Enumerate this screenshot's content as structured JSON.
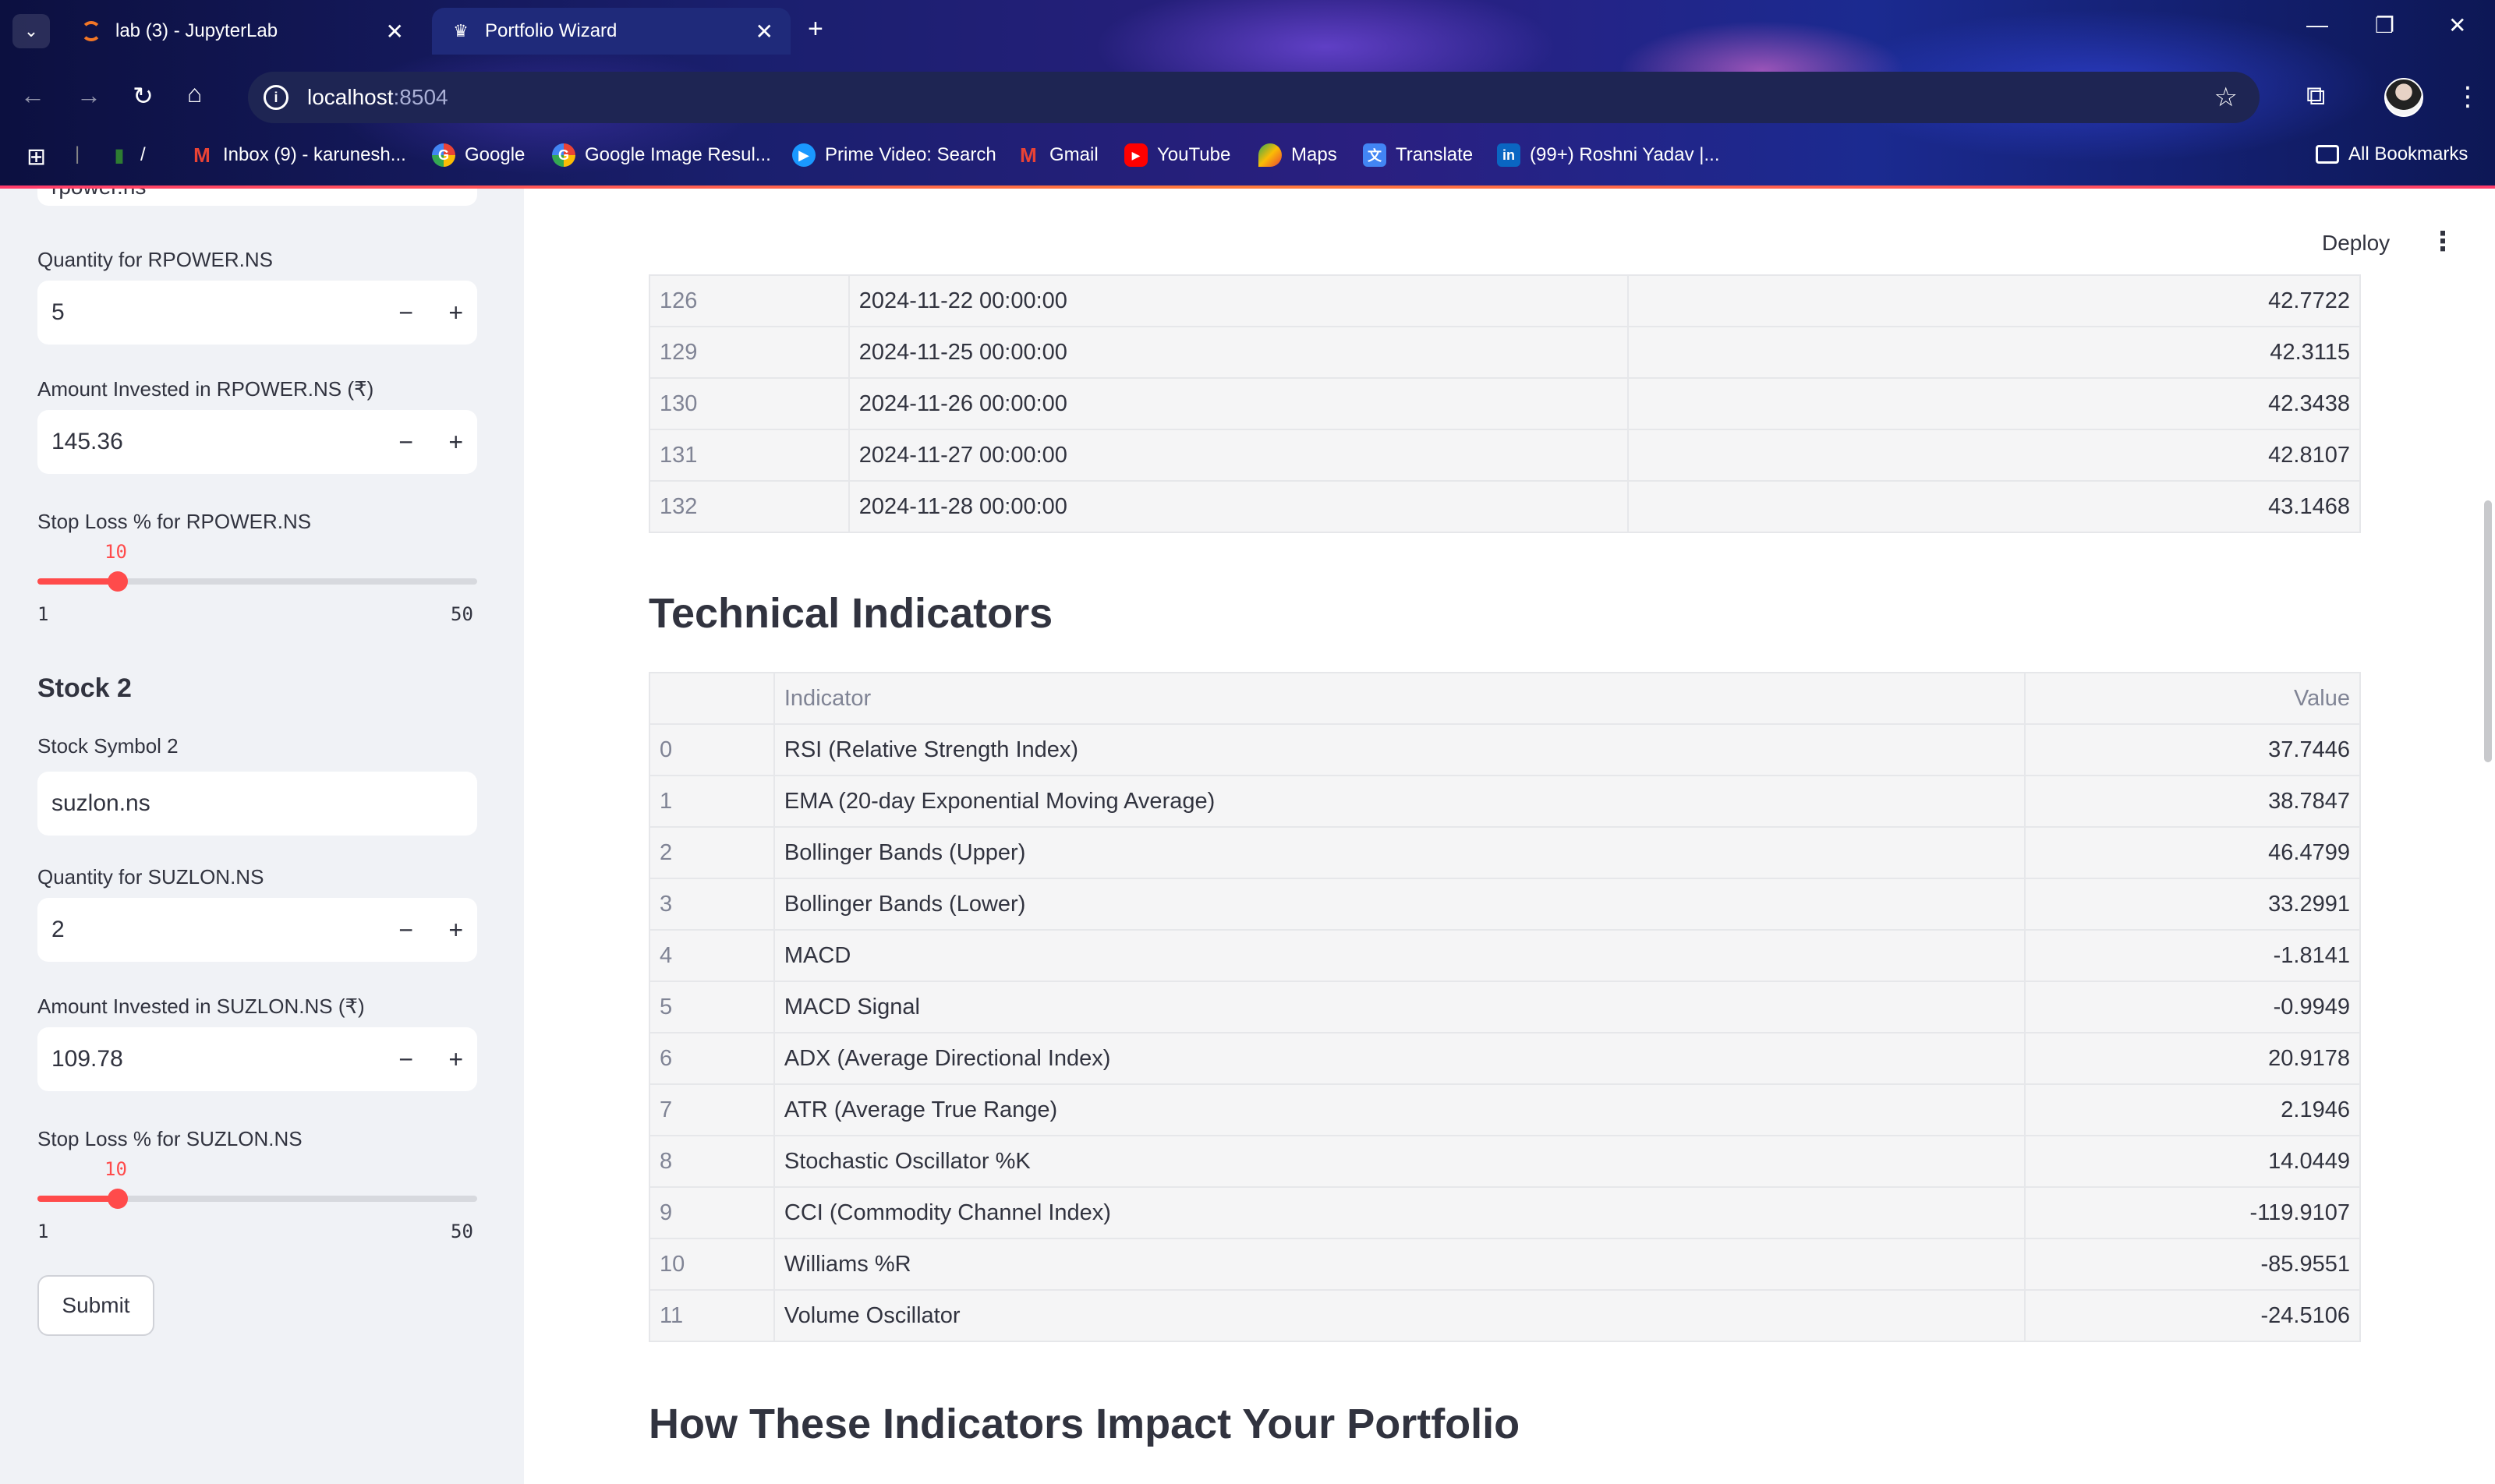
{
  "browser": {
    "tabs": [
      {
        "label": "lab (3) - JupyterLab",
        "icon": "jupyter-icon"
      },
      {
        "label": "Portfolio Wizard",
        "icon": "streamlit-crown-icon"
      }
    ],
    "url_host": "localhost",
    "url_port": ":8504",
    "bookmarks": [
      {
        "label": "Inbox (9) - karunesh...",
        "icon": "gmail-icon"
      },
      {
        "label": "Google",
        "icon": "google-icon"
      },
      {
        "label": "Google Image Resul...",
        "icon": "google-icon"
      },
      {
        "label": "Prime Video: Search",
        "icon": "prime-video-icon"
      },
      {
        "label": "Gmail",
        "icon": "gmail-icon"
      },
      {
        "label": "YouTube",
        "icon": "youtube-icon"
      },
      {
        "label": "Maps",
        "icon": "maps-icon"
      },
      {
        "label": "Translate",
        "icon": "translate-icon"
      },
      {
        "label": "(99+) Roshni Yadav |...",
        "icon": "linkedin-icon"
      }
    ],
    "bookmark_sep": "/",
    "all_bookmarks": "All Bookmarks"
  },
  "sidebar": {
    "stock1_symbol_value": "rpower.ns",
    "stock1_qty_label": "Quantity for RPOWER.NS",
    "stock1_qty_value": "5",
    "stock1_amount_label": "Amount Invested in RPOWER.NS (₹)",
    "stock1_amount_value": "145.36",
    "stock1_stoploss_label": "Stop Loss % for RPOWER.NS",
    "stock1_stoploss_value": "10",
    "stock2_heading": "Stock 2",
    "stock2_symbol_label": "Stock Symbol 2",
    "stock2_symbol_value": "suzlon.ns",
    "stock2_qty_label": "Quantity for SUZLON.NS",
    "stock2_qty_value": "2",
    "stock2_amount_label": "Amount Invested in SUZLON.NS (₹)",
    "stock2_amount_value": "109.78",
    "stock2_stoploss_label": "Stop Loss % for SUZLON.NS",
    "stock2_stoploss_value": "10",
    "slider_min": "1",
    "slider_max": "50",
    "stoploss_fraction": 0.1837,
    "submit_label": "Submit"
  },
  "main": {
    "deploy_label": "Deploy",
    "price_rows": [
      {
        "idx": "126",
        "date": "2024-11-22 00:00:00",
        "value": "42.7722"
      },
      {
        "idx": "129",
        "date": "2024-11-25 00:00:00",
        "value": "42.3115"
      },
      {
        "idx": "130",
        "date": "2024-11-26 00:00:00",
        "value": "42.3438"
      },
      {
        "idx": "131",
        "date": "2024-11-27 00:00:00",
        "value": "42.8107"
      },
      {
        "idx": "132",
        "date": "2024-11-28 00:00:00",
        "value": "43.1468"
      }
    ],
    "tech_title": "Technical Indicators",
    "tech_headers": {
      "indicator": "Indicator",
      "value": "Value"
    },
    "tech_rows": [
      {
        "idx": "0",
        "indicator": "RSI (Relative Strength Index)",
        "value": "37.7446"
      },
      {
        "idx": "1",
        "indicator": "EMA (20-day Exponential Moving Average)",
        "value": "38.7847"
      },
      {
        "idx": "2",
        "indicator": "Bollinger Bands (Upper)",
        "value": "46.4799"
      },
      {
        "idx": "3",
        "indicator": "Bollinger Bands (Lower)",
        "value": "33.2991"
      },
      {
        "idx": "4",
        "indicator": "MACD",
        "value": "-1.8141"
      },
      {
        "idx": "5",
        "indicator": "MACD Signal",
        "value": "-0.9949"
      },
      {
        "idx": "6",
        "indicator": "ADX (Average Directional Index)",
        "value": "20.9178"
      },
      {
        "idx": "7",
        "indicator": "ATR (Average True Range)",
        "value": "2.1946"
      },
      {
        "idx": "8",
        "indicator": "Stochastic Oscillator %K",
        "value": "14.0449"
      },
      {
        "idx": "9",
        "indicator": "CCI (Commodity Channel Index)",
        "value": "-119.9107"
      },
      {
        "idx": "10",
        "indicator": "Williams %R",
        "value": "-85.9551"
      },
      {
        "idx": "11",
        "indicator": "Volume Oscillator",
        "value": "-24.5106"
      }
    ],
    "impact_title": "How These Indicators Impact Your Portfolio"
  },
  "colors": {
    "accent": "#ff4b4b",
    "sidebar_bg": "#f0f2f6",
    "text": "#31333f"
  }
}
